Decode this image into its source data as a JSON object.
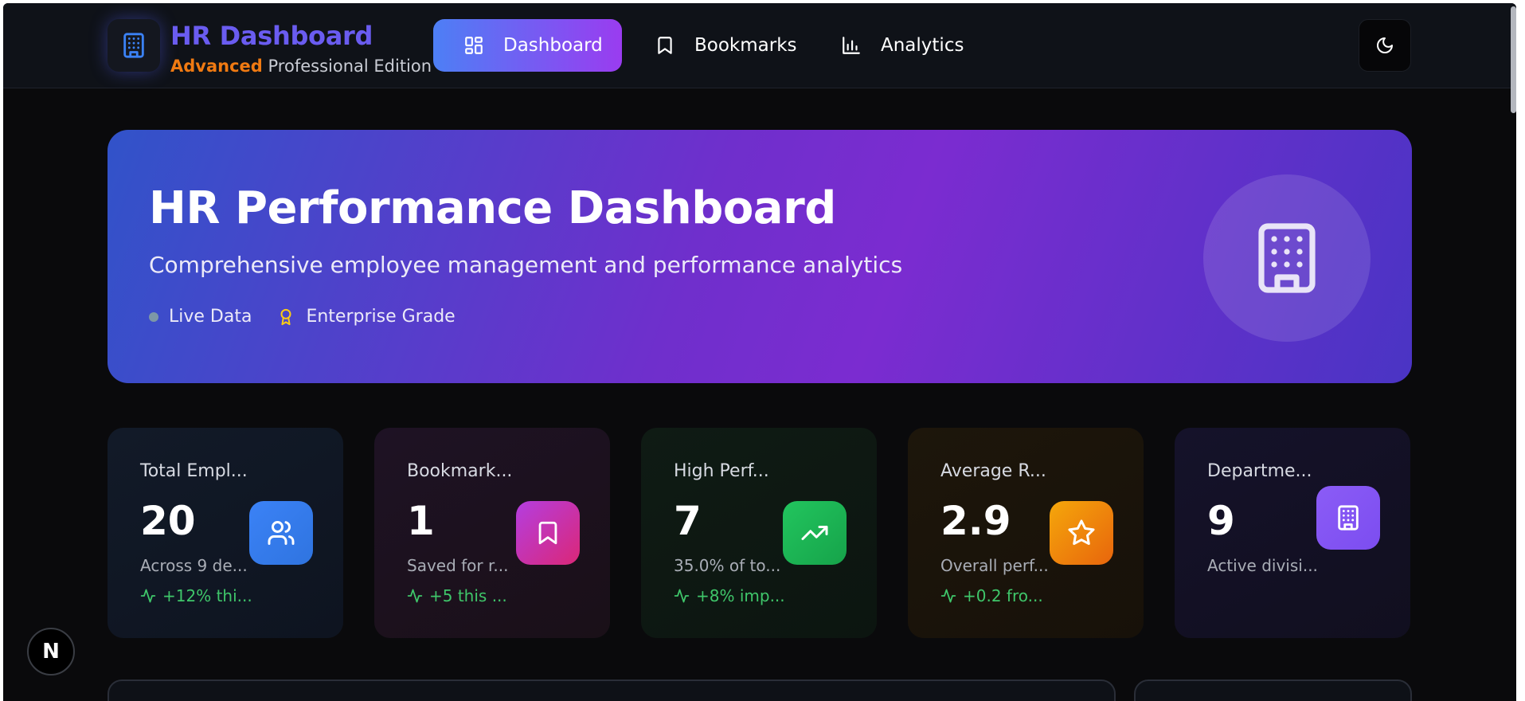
{
  "nav": {
    "brand_title": "HR Dashboard",
    "brand_sub_accent": "Advanced",
    "brand_sub_rest": " Professional Edition",
    "items": [
      {
        "label": "Dashboard",
        "icon": "dashboard-grid-icon",
        "active": true
      },
      {
        "label": "Bookmarks",
        "icon": "bookmark-icon",
        "active": false
      },
      {
        "label": "Analytics",
        "icon": "bar-chart-icon",
        "active": false
      }
    ],
    "theme_icon": "moon-icon"
  },
  "hero": {
    "title": "HR Performance Dashboard",
    "subtitle": "Comprehensive employee management and performance analytics",
    "tag_live": "Live Data",
    "tag_grade": "Enterprise Grade",
    "icon": "building-icon"
  },
  "cards": [
    {
      "label": "Total Empl...",
      "value": "20",
      "desc": "Across 9 de...",
      "trend": "+12% thi...",
      "icon": "users-icon",
      "color": "#3b82f6"
    },
    {
      "label": "Bookmark...",
      "value": "1",
      "desc": "Saved for r...",
      "trend": "+5 this ...",
      "icon": "bookmark-icon",
      "color": "#c026d3"
    },
    {
      "label": "High Perf...",
      "value": "7",
      "desc": "35.0% of to...",
      "trend": "+8% imp...",
      "icon": "trending-up-icon",
      "color": "#22c55e"
    },
    {
      "label": "Average R...",
      "value": "2.9",
      "desc": "Overall perf...",
      "trend": "+0.2 fro...",
      "icon": "star-icon",
      "color": "#f59e0b"
    },
    {
      "label": "Departme...",
      "value": "9",
      "desc": "Active divisi...",
      "trend": "",
      "icon": "building-icon",
      "color": "#8b5cf6"
    }
  ],
  "fab_label": "N"
}
